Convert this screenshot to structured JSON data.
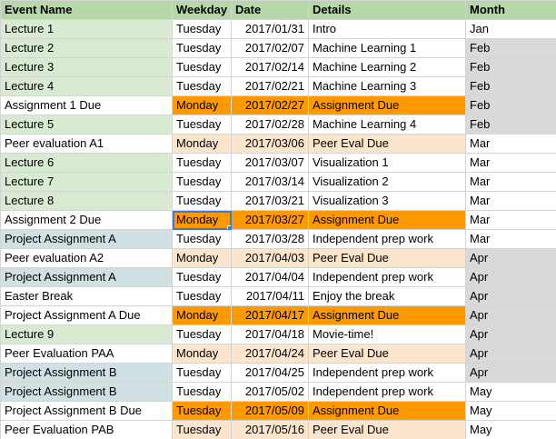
{
  "colors": {
    "header_bg": "#b6d7a8",
    "lecture_bg": "#d9ead3",
    "project_bg": "#d0e0e3",
    "assignment_due_bg": "#ff9900",
    "peer_eval_bg": "#fce5cd",
    "month_gray_bg": "#d9d9d9",
    "white": "#ffffff"
  },
  "columns": [
    "Event Name",
    "Weekday",
    "Date",
    "Details",
    "Month"
  ],
  "rows": [
    {
      "event": "Lecture 1",
      "weekday": "Tuesday",
      "date": "2017/01/31",
      "details": "Intro",
      "month": "Jan",
      "event_bg": "lecture_bg",
      "mid_bg": "white",
      "month_bg": "white"
    },
    {
      "event": "Lecture 2",
      "weekday": "Tuesday",
      "date": "2017/02/07",
      "details": "Machine Learning 1",
      "month": "Feb",
      "event_bg": "lecture_bg",
      "mid_bg": "white",
      "month_bg": "month_gray_bg"
    },
    {
      "event": "Lecture 3",
      "weekday": "Tuesday",
      "date": "2017/02/14",
      "details": "Machine Learning 2",
      "month": "Feb",
      "event_bg": "lecture_bg",
      "mid_bg": "white",
      "month_bg": "month_gray_bg"
    },
    {
      "event": "Lecture 4",
      "weekday": "Tuesday",
      "date": "2017/02/21",
      "details": "Machine Learning 3",
      "month": "Feb",
      "event_bg": "lecture_bg",
      "mid_bg": "white",
      "month_bg": "month_gray_bg"
    },
    {
      "event": "Assignment 1 Due",
      "weekday": "Monday",
      "date": "2017/02/27",
      "details": "Assignment Due",
      "month": "Feb",
      "event_bg": "white",
      "mid_bg": "assignment_due_bg",
      "month_bg": "month_gray_bg"
    },
    {
      "event": "Lecture 5",
      "weekday": "Tuesday",
      "date": "2017/02/28",
      "details": "Machine Learning 4",
      "month": "Feb",
      "event_bg": "lecture_bg",
      "mid_bg": "white",
      "month_bg": "month_gray_bg"
    },
    {
      "event": "Peer evaluation A1",
      "weekday": "Monday",
      "date": "2017/03/06",
      "details": "Peer Eval Due",
      "month": "Mar",
      "event_bg": "white",
      "mid_bg": "peer_eval_bg",
      "month_bg": "white"
    },
    {
      "event": "Lecture 6",
      "weekday": "Tuesday",
      "date": "2017/03/07",
      "details": "Visualization 1",
      "month": "Mar",
      "event_bg": "lecture_bg",
      "mid_bg": "white",
      "month_bg": "white"
    },
    {
      "event": "Lecture 7",
      "weekday": "Tuesday",
      "date": "2017/03/14",
      "details": "Visualization 2",
      "month": "Mar",
      "event_bg": "lecture_bg",
      "mid_bg": "white",
      "month_bg": "white"
    },
    {
      "event": "Lecture 8",
      "weekday": "Tuesday",
      "date": "2017/03/21",
      "details": "Visualization 3",
      "month": "Mar",
      "event_bg": "lecture_bg",
      "mid_bg": "white",
      "month_bg": "white"
    },
    {
      "event": "Assignment 2 Due",
      "weekday": "Monday",
      "date": "2017/03/27",
      "details": "Assignment Due",
      "month": "Mar",
      "event_bg": "white",
      "mid_bg": "assignment_due_bg",
      "month_bg": "white",
      "selected_weekday": true
    },
    {
      "event": "Project Assignment A",
      "weekday": "Tuesday",
      "date": "2017/03/28",
      "details": "Independent prep work",
      "month": "Mar",
      "event_bg": "project_bg",
      "mid_bg": "white",
      "month_bg": "white"
    },
    {
      "event": "Peer evaluation A2",
      "weekday": "Monday",
      "date": "2017/04/03",
      "details": "Peer Eval Due",
      "month": "Apr",
      "event_bg": "white",
      "mid_bg": "peer_eval_bg",
      "month_bg": "month_gray_bg"
    },
    {
      "event": "Project Assignment A",
      "weekday": "Tuesday",
      "date": "2017/04/04",
      "details": "Independent prep work",
      "month": "Apr",
      "event_bg": "project_bg",
      "mid_bg": "white",
      "month_bg": "month_gray_bg"
    },
    {
      "event": "Easter Break",
      "weekday": "Tuesday",
      "date": "2017/04/11",
      "details": "Enjoy the break",
      "month": "Apr",
      "event_bg": "white",
      "mid_bg": "white",
      "month_bg": "month_gray_bg"
    },
    {
      "event": "Project Assignment A Due",
      "weekday": "Monday",
      "date": "2017/04/17",
      "details": "Assignment Due",
      "month": "Apr",
      "event_bg": "white",
      "mid_bg": "assignment_due_bg",
      "month_bg": "month_gray_bg"
    },
    {
      "event": "Lecture 9",
      "weekday": "Tuesday",
      "date": "2017/04/18",
      "details": "Movie-time!",
      "month": "Apr",
      "event_bg": "lecture_bg",
      "mid_bg": "white",
      "month_bg": "month_gray_bg"
    },
    {
      "event": "Peer Evaluation PAA",
      "weekday": "Monday",
      "date": "2017/04/24",
      "details": "Peer Eval Due",
      "month": "Apr",
      "event_bg": "white",
      "mid_bg": "peer_eval_bg",
      "month_bg": "month_gray_bg"
    },
    {
      "event": "Project Assignment B",
      "weekday": "Tuesday",
      "date": "2017/04/25",
      "details": "Independent prep work",
      "month": "Apr",
      "event_bg": "project_bg",
      "mid_bg": "white",
      "month_bg": "month_gray_bg"
    },
    {
      "event": "Project Assignment B",
      "weekday": "Tuesday",
      "date": "2017/05/02",
      "details": "Independent prep work",
      "month": "May",
      "event_bg": "project_bg",
      "mid_bg": "white",
      "month_bg": "white"
    },
    {
      "event": "Project Assignment B Due",
      "weekday": "Tuesday",
      "date": "2017/05/09",
      "details": "Assignment Due",
      "month": "May",
      "event_bg": "white",
      "mid_bg": "assignment_due_bg",
      "month_bg": "white"
    },
    {
      "event": "Peer Evaluation PAB",
      "weekday": "Tuesday",
      "date": "2017/05/16",
      "details": "Peer Eval Due",
      "month": "May",
      "event_bg": "white",
      "mid_bg": "peer_eval_bg",
      "month_bg": "white"
    }
  ]
}
